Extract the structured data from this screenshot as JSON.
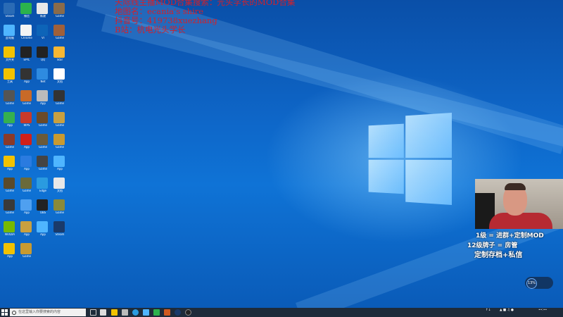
{
  "overlay": {
    "line1": "天际线主播MOD合集搜索：光头学长的MOD合集",
    "line2": "地图名：ecania's shire",
    "line3": "抖音号：419738xuezhang",
    "line4": "B站：杭电光头学长"
  },
  "promo": {
    "line1": "1级 = 进群+定制MOD",
    "line2": "12级牌子 = 房管",
    "line3": "定制存档+私信"
  },
  "netwidget": {
    "percent": "13%"
  },
  "taskbar": {
    "search_placeholder": "在这里输入你要搜索的内容"
  },
  "desktop_icons": [
    {
      "label": "Steam",
      "color": "#2a6bb5"
    },
    {
      "label": "微信",
      "color": "#2bb24c"
    },
    {
      "label": "新建",
      "color": "#e8e8e8"
    },
    {
      "label": "Game",
      "color": "#8a6b4a"
    },
    {
      "label": "此电脑",
      "color": "#4fb5ff"
    },
    {
      "label": "Chrome",
      "color": "#f4f4f4"
    },
    {
      "label": "VI",
      "color": "#0d64b8"
    },
    {
      "label": "Game",
      "color": "#a0603a"
    },
    {
      "label": "文件夹",
      "color": "#f2c200"
    },
    {
      "label": "EPIC",
      "color": "#222"
    },
    {
      "label": "QQ",
      "color": "#222"
    },
    {
      "label": "Star",
      "color": "#f7b733"
    },
    {
      "label": "工具",
      "color": "#f2c200"
    },
    {
      "label": "App",
      "color": "#333"
    },
    {
      "label": "Net",
      "color": "#2e8be0"
    },
    {
      "label": "文档",
      "color": "#fff"
    },
    {
      "label": "Game",
      "color": "#555"
    },
    {
      "label": "Game",
      "color": "#c86a28"
    },
    {
      "label": "App",
      "color": "#bbb"
    },
    {
      "label": "Game",
      "color": "#333"
    },
    {
      "label": "App",
      "color": "#35b050"
    },
    {
      "label": "WPS",
      "color": "#c83a2a"
    },
    {
      "label": "Game",
      "color": "#6a4a2a"
    },
    {
      "label": "Game",
      "color": "#c8a040"
    },
    {
      "label": "Game",
      "color": "#8a3a2a"
    },
    {
      "label": "App",
      "color": "#d0201a"
    },
    {
      "label": "Game",
      "color": "#6a5a3a"
    },
    {
      "label": "Game",
      "color": "#c89a30"
    },
    {
      "label": "App",
      "color": "#f2c200"
    },
    {
      "label": "App",
      "color": "#2a7be0"
    },
    {
      "label": "Game",
      "color": "#444"
    },
    {
      "label": "App",
      "color": "#4fb5ff"
    },
    {
      "label": "Game",
      "color": "#5a4a2a"
    },
    {
      "label": "Game",
      "color": "#6a6a3a"
    },
    {
      "label": "Edge",
      "color": "#2a9be0"
    },
    {
      "label": "文档",
      "color": "#e8e8e8"
    },
    {
      "label": "Game",
      "color": "#3a3a3a"
    },
    {
      "label": "App",
      "color": "#4fa0f0"
    },
    {
      "label": "OBS",
      "color": "#222"
    },
    {
      "label": "Game",
      "color": "#8a8a3a"
    },
    {
      "label": "NVIDIA",
      "color": "#76b900"
    },
    {
      "label": "App",
      "color": "#c8a040"
    },
    {
      "label": "App",
      "color": "#4fb5ff"
    },
    {
      "label": "Steam",
      "color": "#1a3a6a"
    },
    {
      "label": "App",
      "color": "#f2c200"
    },
    {
      "label": "Game",
      "color": "#c89a30"
    }
  ]
}
